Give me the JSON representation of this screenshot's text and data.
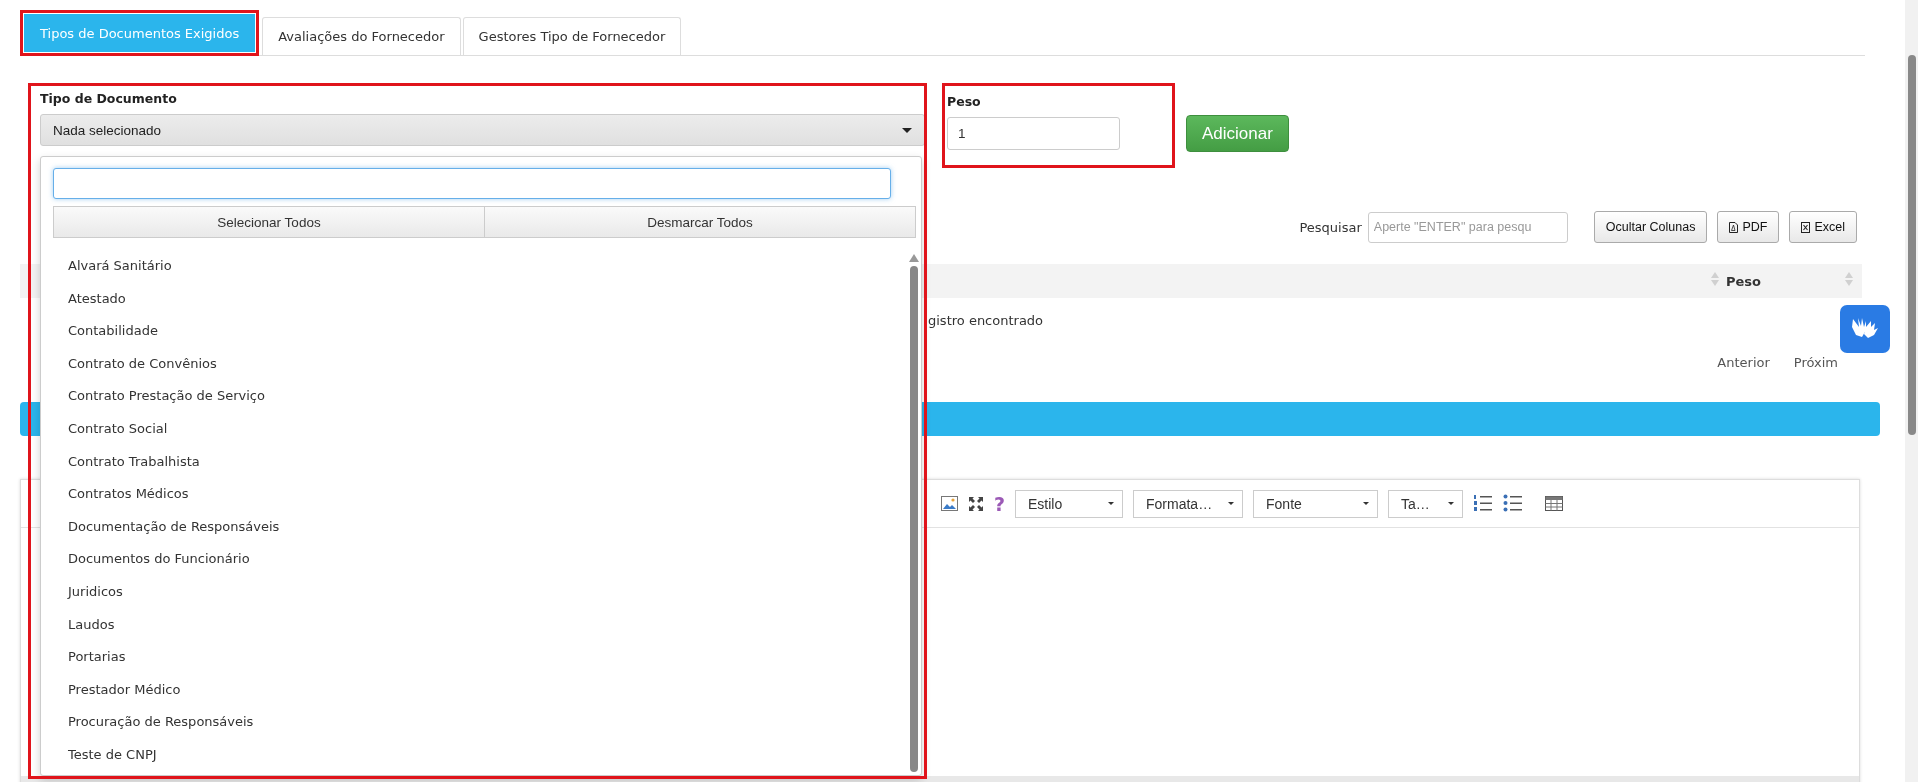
{
  "tabs": [
    {
      "label": "Tipos de Documentos Exigidos",
      "selected": true
    },
    {
      "label": "Avaliações do Fornecedor",
      "selected": false
    },
    {
      "label": "Gestores Tipo de Fornecedor",
      "selected": false
    }
  ],
  "form": {
    "document_type": {
      "label": "Tipo de Documento",
      "value": "Nada selecionado",
      "expanded": true,
      "select_all": "Selecionar Todos",
      "deselect_all": "Desmarcar Todos",
      "options": [
        "Alvará Sanitário",
        "Atestado",
        "Contabilidade",
        "Contrato de Convênios",
        "Contrato Prestação de Serviço",
        "Contrato Social",
        "Contrato Trabalhista",
        "Contratos Médicos",
        "Documentação de Responsáveis",
        "Documentos do Funcionário",
        "Juridicos",
        "Laudos",
        "Portarias",
        "Prestador Médico",
        "Procuração de Responsáveis",
        "Teste de CNPJ"
      ]
    },
    "weight": {
      "label": "Peso",
      "value": "1"
    },
    "add_button": "Adicionar"
  },
  "table_toolbar": {
    "search_label": "Pesquisar",
    "search_placeholder": "Aperte \"ENTER\" para pesqu",
    "buttons": [
      {
        "label": "Ocultar Colunas",
        "kind": "plain"
      },
      {
        "label": "PDF",
        "kind": "pdf"
      },
      {
        "label": "Excel",
        "kind": "excel"
      }
    ]
  },
  "table": {
    "columns": [
      "Peso"
    ],
    "empty_text": "gistro encontrado"
  },
  "pagination": [
    "Anterior",
    "Próxim"
  ],
  "editor": {
    "help": "?",
    "dropdowns": [
      "Estilo",
      "Formata…",
      "Fonte",
      "Ta…"
    ]
  }
}
